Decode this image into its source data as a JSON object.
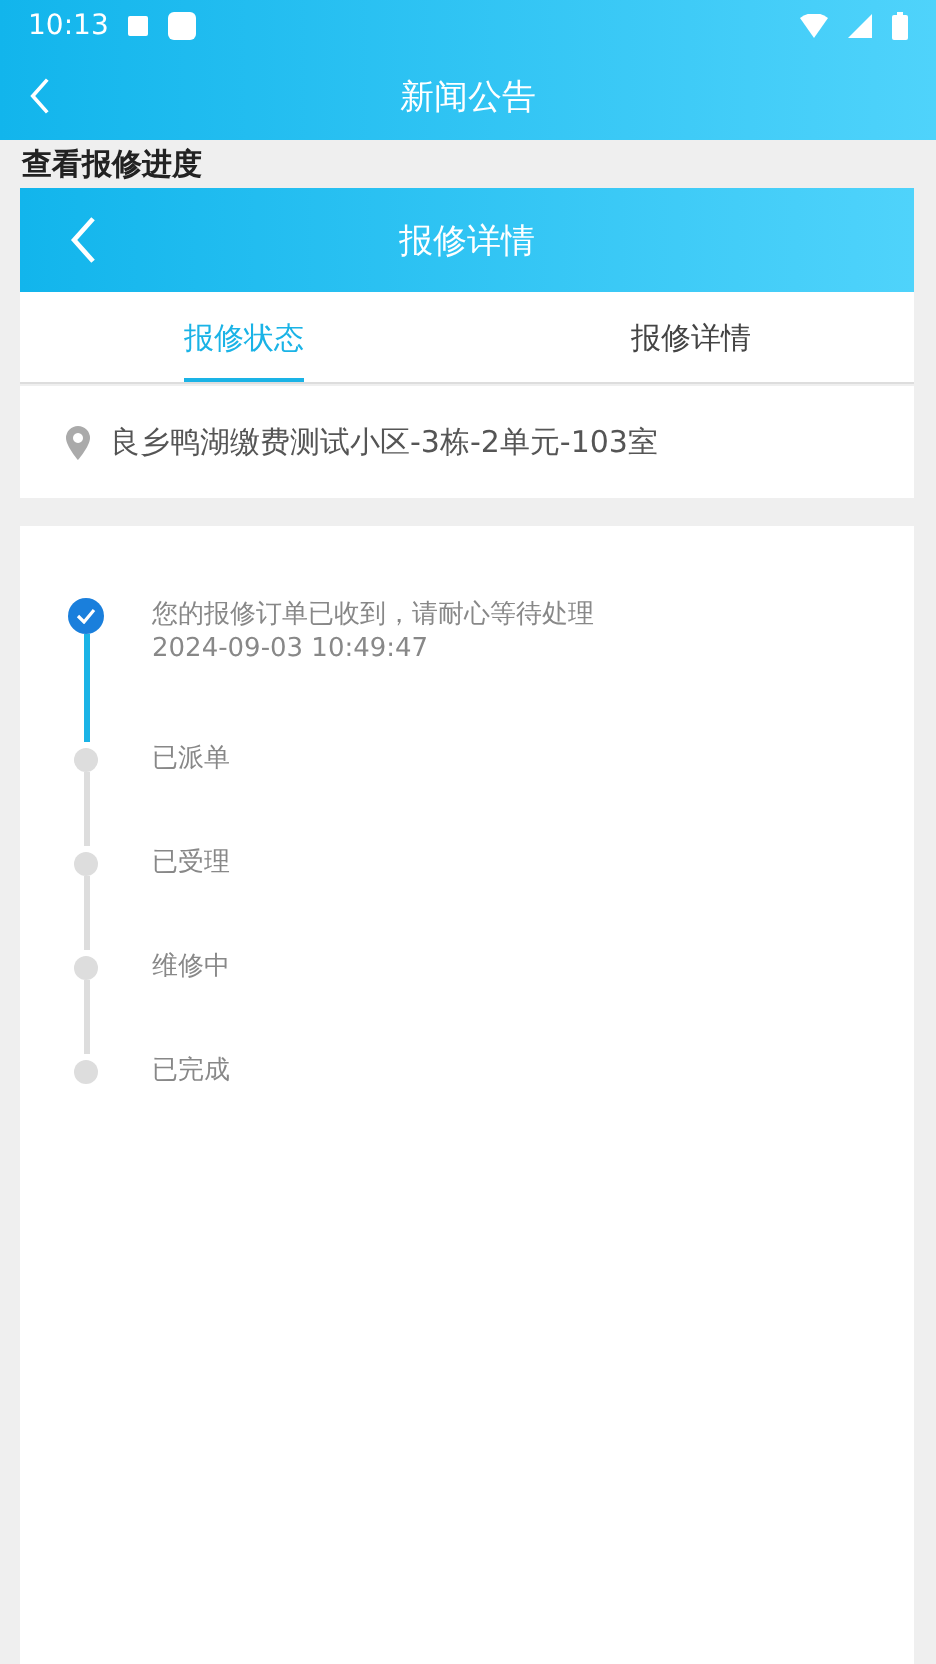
{
  "status_bar": {
    "time": "10:13"
  },
  "app_bar": {
    "title": "新闻公告"
  },
  "section_title": "查看报修进度",
  "inner_header": {
    "title": "报修详情"
  },
  "tabs": [
    {
      "label": "报修状态",
      "selected": true
    },
    {
      "label": "报修详情",
      "selected": false
    }
  ],
  "address": "良乡鸭湖缴费测试小区-3栋-2单元-103室",
  "steps": [
    {
      "label": "您的报修订单已收到，请耐心等待处理",
      "time": "2024-09-03 10:49:47",
      "done": true
    },
    {
      "label": "已派单",
      "done": false
    },
    {
      "label": "已受理",
      "done": false
    },
    {
      "label": "维修中",
      "done": false
    },
    {
      "label": "已完成",
      "done": false
    }
  ]
}
